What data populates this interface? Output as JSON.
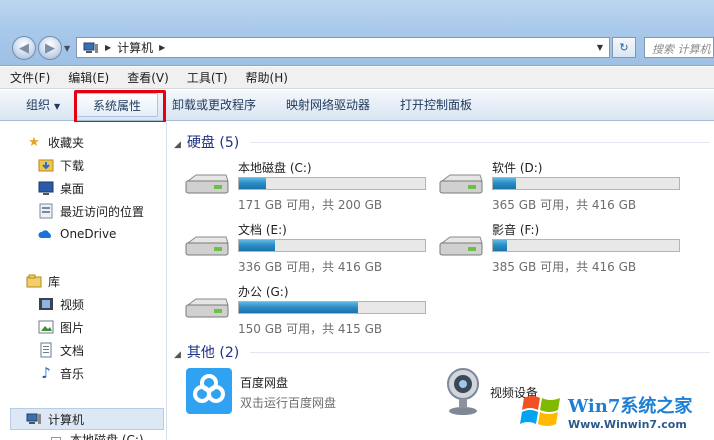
{
  "address": {
    "path": "计算机",
    "search_placeholder": "搜索 计算机"
  },
  "menu": [
    "文件(F)",
    "编辑(E)",
    "查看(V)",
    "工具(T)",
    "帮助(H)"
  ],
  "toolbar": {
    "organize": "组织",
    "system_properties": "系统属性",
    "uninstall": "卸载或更改程序",
    "map_drive": "映射网络驱动器",
    "control_panel": "打开控制面板"
  },
  "sidebar": {
    "favorites": "收藏夹",
    "downloads": "下载",
    "desktop": "桌面",
    "recent": "最近访问的位置",
    "onedrive": "OneDrive",
    "libraries": "库",
    "videos": "视频",
    "pictures": "图片",
    "documents": "文档",
    "music": "音乐",
    "computer": "计算机",
    "local_disk_partial": "本地磁盘 (C:)"
  },
  "groups": {
    "hdd": "硬盘 (5)",
    "other": "其他 (2)"
  },
  "drives": [
    {
      "name": "本地磁盘 (C:)",
      "free": "171 GB 可用，共 200 GB",
      "used_fraction": 0.145
    },
    {
      "name": "软件 (D:)",
      "free": "365 GB 可用，共 416 GB",
      "used_fraction": 0.123
    },
    {
      "name": "文档 (E:)",
      "free": "336 GB 可用，共 416 GB",
      "used_fraction": 0.192
    },
    {
      "name": "影音 (F:)",
      "free": "385 GB 可用，共 416 GB",
      "used_fraction": 0.075
    },
    {
      "name": "办公 (G:)",
      "free": "150 GB 可用，共 415 GB",
      "used_fraction": 0.639
    }
  ],
  "others": {
    "baidu_name": "百度网盘",
    "baidu_sub": "双击运行百度网盘",
    "camera_name": "视频设备"
  },
  "watermark": {
    "brand": "Win7系统之家",
    "url": "Www.Winwin7.com"
  },
  "colors": {
    "accent": "#1e3287",
    "highlight": "#e60012",
    "drive_fill": "#2a8ac4"
  }
}
